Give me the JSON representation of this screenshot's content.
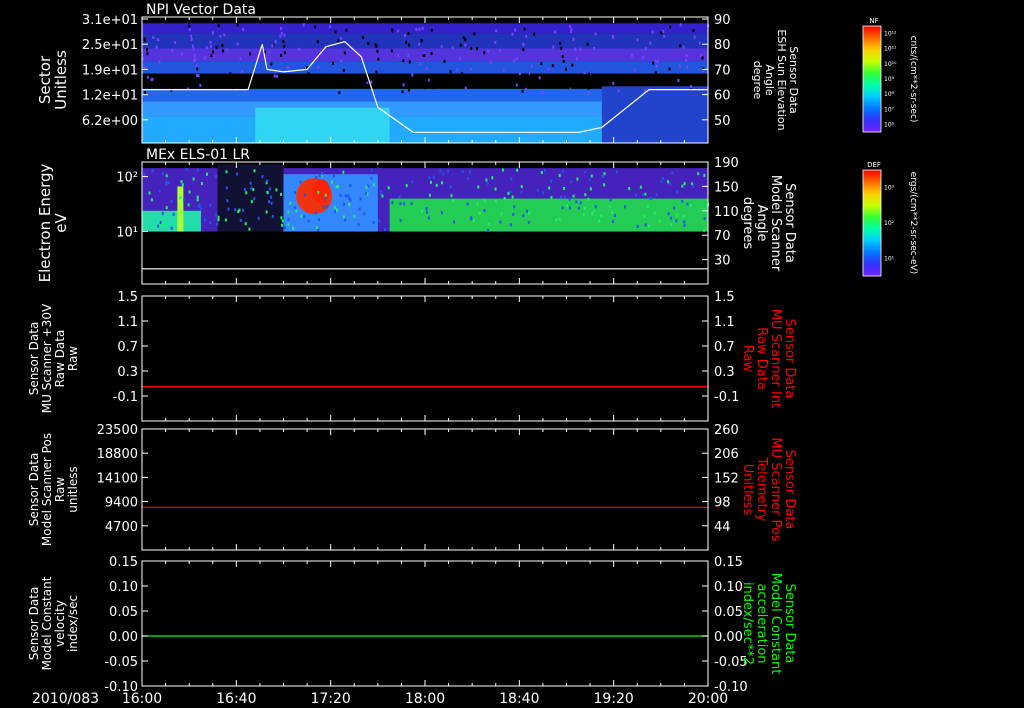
{
  "colors": {
    "background": "#000000",
    "axis": "#ffffff",
    "red_trace": "#ff0000",
    "green_trace": "#00ff00",
    "white_trace": "#ffffff"
  },
  "time_axis": {
    "date_label": "2010/083",
    "ticks": [
      "16:00",
      "16:40",
      "17:20",
      "18:00",
      "18:40",
      "19:20",
      "20:00"
    ]
  },
  "colorbars": [
    {
      "label": "NF",
      "units": "cnts/(cm**2-sr-sec)",
      "ticks": [
        "10¹²",
        "10¹¹",
        "10¹⁰",
        "10⁹",
        "10⁸",
        "10⁷",
        "10⁶"
      ]
    },
    {
      "label": "DEF",
      "units": "ergs/(cm**2-sr-sec-eV)",
      "ticks": [
        "10³",
        "10²",
        "10¹"
      ]
    }
  ],
  "chart_data": [
    {
      "type": "heatmap",
      "title": "NPI Vector Data",
      "ylabel": [
        "Sector",
        "Unitless"
      ],
      "yticks": [
        "3.1e+01",
        "2.5e+01",
        "1.9e+01",
        "1.2e+01",
        "6.2e+00"
      ],
      "ylabel_right": [
        "Sensor Data",
        "ESH Sun Elevation",
        "Angle",
        "degree"
      ],
      "yticks_right": [
        "90",
        "80",
        "70",
        "60",
        "50"
      ],
      "ylim_right": [
        40,
        90
      ],
      "line_series": {
        "x": [
          "16:00",
          "16:45",
          "16:51",
          "16:53",
          "17:00",
          "17:10",
          "17:18",
          "17:26",
          "17:33",
          "17:40",
          "17:55",
          "18:40",
          "19:05",
          "19:15",
          "19:35",
          "20:00"
        ],
        "y": [
          62,
          62,
          80,
          70,
          69,
          70,
          79,
          81,
          75,
          55,
          45,
          45,
          45,
          47,
          62,
          62
        ]
      }
    },
    {
      "type": "heatmap",
      "title": "MEx ELS-01 LR",
      "ylabel": [
        "Electron Energy",
        "eV"
      ],
      "yticks": [
        "10²",
        "10¹"
      ],
      "ylabel_right": [
        "Sensor Data",
        "Model Scanner",
        "Angle",
        "degrees"
      ],
      "yticks_right": [
        "190",
        "150",
        "110",
        "70",
        "30"
      ],
      "ylim_right": [
        0,
        190
      ],
      "line_series": {
        "x": [
          "16:00",
          "20:00"
        ],
        "y": [
          15,
          15
        ]
      }
    },
    {
      "type": "line",
      "ylabel": [
        "Sensor Data",
        "MU Scanner +30V",
        "Raw Data",
        "Raw"
      ],
      "yticks": [
        "1.5",
        "1.1",
        "0.7",
        "0.3",
        "-0.1"
      ],
      "ylim": [
        -0.5,
        1.5
      ],
      "ylabel_right": [
        "Sensor Data",
        "MU Scanner Int",
        "Raw Data",
        "Raw"
      ],
      "yticks_right": [
        "1.5",
        "1.1",
        "0.7",
        "0.3",
        "-0.1"
      ],
      "series": [
        {
          "x": [
            "16:00",
            "20:00"
          ],
          "values": [
            0.05,
            0.05
          ]
        }
      ]
    },
    {
      "type": "line",
      "ylabel": [
        "Sensor Data",
        "Model Scanner Pos",
        "Raw",
        "unitless"
      ],
      "yticks": [
        "23500",
        "18800",
        "14100",
        "9400",
        "4700"
      ],
      "ylim": [
        0,
        23500
      ],
      "ylabel_right": [
        "Sensor Data",
        "MU Scanner Pos",
        "Telemetry",
        "Unitless"
      ],
      "yticks_right": [
        "260",
        "206",
        "152",
        "98",
        "44"
      ],
      "series": [
        {
          "x": [
            "16:00",
            "20:00"
          ],
          "values": [
            8300,
            8300
          ]
        }
      ]
    },
    {
      "type": "line",
      "ylabel": [
        "Sensor Data",
        "Model Constant",
        "velocity",
        "index/sec"
      ],
      "yticks": [
        "0.15",
        "0.10",
        "0.05",
        "0.00",
        "-0.05",
        "-0.10"
      ],
      "ylim": [
        -0.1,
        0.15
      ],
      "ylabel_right": [
        "Sensor Data",
        "Model Constant",
        "acceleration",
        "index/sec**2"
      ],
      "yticks_right": [
        "0.15",
        "0.10",
        "0.05",
        "0.00",
        "-0.05",
        "-0.10"
      ],
      "series": [
        {
          "x": [
            "16:00",
            "20:00"
          ],
          "values": [
            0.0,
            0.0
          ]
        }
      ]
    }
  ]
}
